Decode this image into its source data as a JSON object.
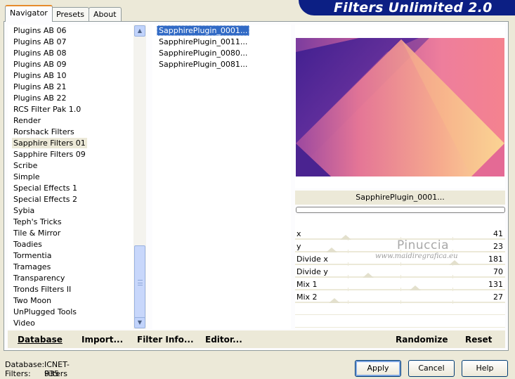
{
  "tabs": [
    "Navigator",
    "Presets",
    "About"
  ],
  "banner_title": "Filters Unlimited 2.0",
  "categories": [
    "Plugins AB 06",
    "Plugins AB 07",
    "Plugins AB 08",
    "Plugins AB 09",
    "Plugins AB 10",
    "Plugins AB 21",
    "Plugins AB 22",
    "RCS Filter Pak 1.0",
    "Render",
    "Rorshack Filters",
    "Sapphire Filters 01",
    "Sapphire Filters 09",
    "Scribe",
    "Simple",
    "Special Effects 1",
    "Special Effects 2",
    "Sybia",
    "Teph's Tricks",
    "Tile & Mirror",
    "Toadies",
    "Tormentia",
    "Tramages",
    "Transparency",
    "Tronds Filters II",
    "Two Moon",
    "UnPlugged Tools",
    "Video"
  ],
  "selected_category": "Sapphire Filters 01",
  "filters": [
    "SapphirePlugin_0001...",
    "SapphirePlugin_0011...",
    "SapphirePlugin_0080...",
    "SapphirePlugin_0081..."
  ],
  "selected_filter_name": "SapphirePlugin_0001...",
  "parameters": [
    {
      "label": "x",
      "value": "41",
      "level": 41
    },
    {
      "label": "y",
      "value": "23",
      "level": 23
    },
    {
      "label": "Divide x",
      "value": "181",
      "level": 181
    },
    {
      "label": "Divide y",
      "value": "70",
      "level": 70
    },
    {
      "label": "Mix 1",
      "value": "131",
      "level": 131
    },
    {
      "label": "Mix 2",
      "value": "27",
      "level": 27
    }
  ],
  "watermark": {
    "name": "Pinuccia",
    "site": "www.maidiregrafica.eu"
  },
  "bottom_links": {
    "database": "Database",
    "import": "Import...",
    "filter_info": "Filter Info...",
    "editor": "Editor...",
    "randomize": "Randomize",
    "reset": "Reset"
  },
  "status": {
    "db_label": "Database:",
    "db_value": "ICNET-Filters",
    "filters_label": "Filters:",
    "filters_value": "935"
  },
  "buttons": {
    "apply": "Apply",
    "cancel": "Cancel",
    "help": "Help"
  },
  "colors": {
    "selection": "#316ac5",
    "banner": "#0c1f84",
    "window_bg": "#ece9d8"
  }
}
